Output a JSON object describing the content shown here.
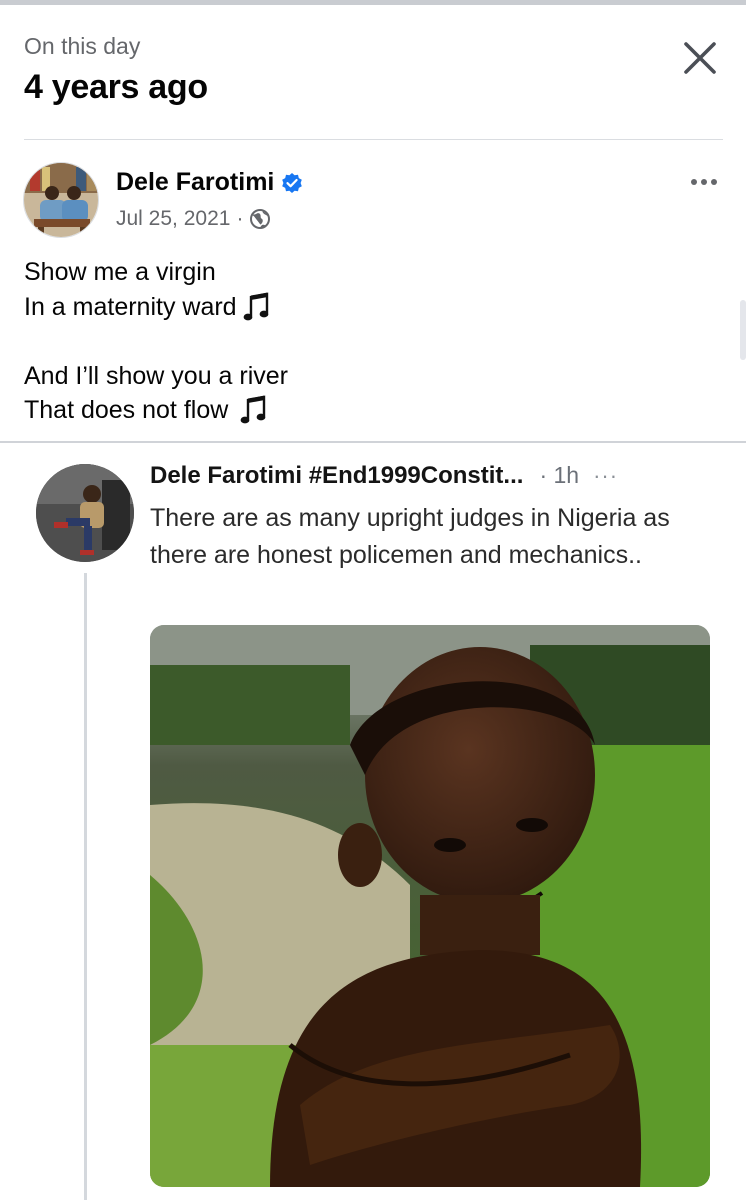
{
  "header": {
    "label": "On this day",
    "title": "4 years ago"
  },
  "post": {
    "author": "Dele Farotimi",
    "verified": true,
    "date": "Jul 25, 2021",
    "separator": "·",
    "privacy_icon": "globe-icon",
    "lines": [
      "Show me a virgin",
      "In a maternity ward",
      "",
      "And I’ll show you a river",
      "That does not flow"
    ],
    "music_icon": "music-note-icon"
  },
  "shared_tweet": {
    "author": "Dele Farotimi #End1999Constit...",
    "time": "· 1h",
    "more": "···",
    "text": "There are as many upright judges in Nigeria as there are honest policemen and mechanics..",
    "image_subject": "child-arms-crossed-smirking"
  },
  "colors": {
    "verified_badge": "#1877f2",
    "secondary_text": "#65676b",
    "divider": "#dadde1"
  }
}
